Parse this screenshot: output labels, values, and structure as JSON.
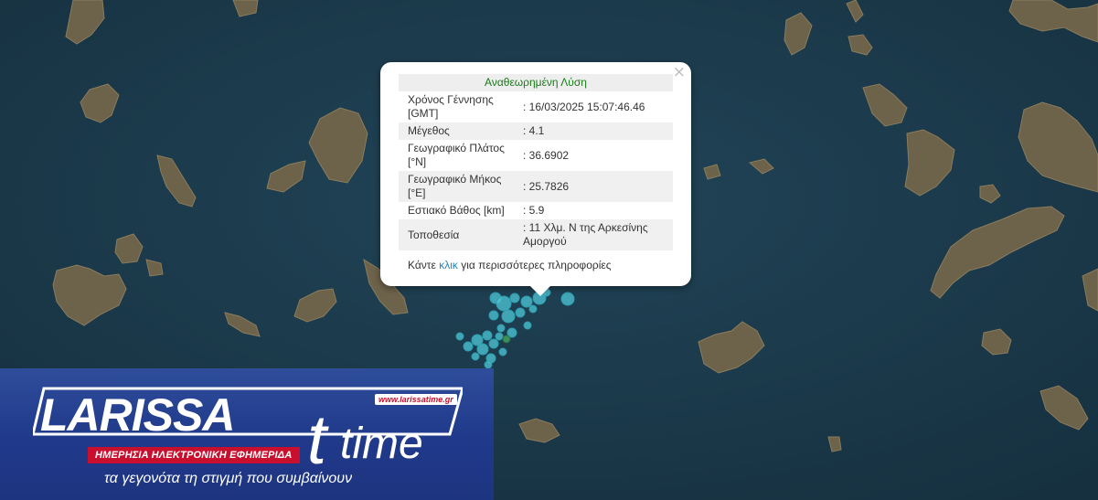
{
  "popup": {
    "header": "Αναθεωρημένη Λύση",
    "rows": [
      {
        "label": "Χρόνος Γέννησης [GMT]",
        "value": ": 16/03/2025 15:07:46.46"
      },
      {
        "label": "Μέγεθος",
        "value": ": 4.1"
      },
      {
        "label": "Γεωγραφικό Πλάτος [°N]",
        "value": ": 36.6902"
      },
      {
        "label": "Γεωγραφικό Μήκος [°E]",
        "value": ": 25.7826"
      },
      {
        "label": "Εστιακό Βάθος [km]",
        "value": ": 5.9"
      },
      {
        "label": "Τοποθεσία",
        "value": ": 11 Χλμ. Ν της Αρκεσίνης Αμοργού"
      }
    ],
    "more_prefix": "Κάντε ",
    "more_link": "κλικ",
    "more_suffix": " για περισσότερες πληροφορίες",
    "close_symbol": "×"
  },
  "banner": {
    "brand_left": "LARISSA",
    "brand_right": "time",
    "brand_t": "t",
    "url": "www.larissatime.gr",
    "subtitle": "ΗΜΕΡΗΣΙΑ ΗΛΕΚΤΡΟΝΙΚΗ ΕΦΗΜΕΡΙΔΑ",
    "tagline": "τα γεγονότα τη στιγμή που συμβαίνουν"
  },
  "colors": {
    "sea": "#1b3a4b",
    "land": "#6b6048",
    "quake_marker": "#4fc8d8",
    "selected_marker": "#3b8f5a",
    "brand_red": "#c8102e",
    "banner_blue": "#20398a"
  }
}
